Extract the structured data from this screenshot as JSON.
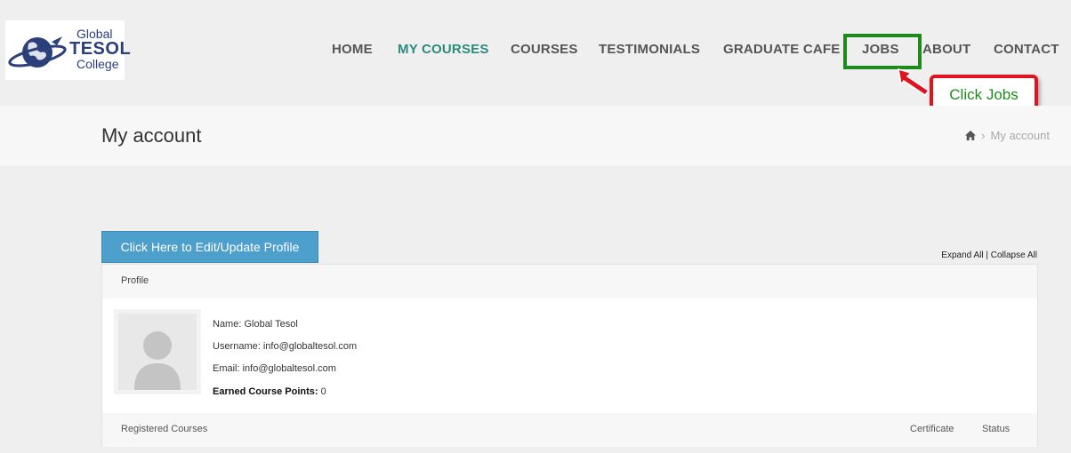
{
  "logo": {
    "line1": "Global",
    "line2": "TESOL",
    "line3": "College"
  },
  "nav": {
    "items": [
      {
        "label": "HOME",
        "active": false
      },
      {
        "label": "MY COURSES",
        "active": true
      },
      {
        "label": "COURSES",
        "active": false
      },
      {
        "label": "TESTIMONIALS",
        "active": false
      },
      {
        "label": "GRADUATE CAFE",
        "active": false
      },
      {
        "label": "JOBS",
        "active": false
      },
      {
        "label": "ABOUT",
        "active": false
      },
      {
        "label": "CONTACT",
        "active": false
      }
    ]
  },
  "annotation": {
    "callout": "Click Jobs",
    "highlight_color": "#1e8a1e",
    "callout_border_color": "#e0141e"
  },
  "page": {
    "title": "My account",
    "breadcrumb_current": "My account"
  },
  "actions": {
    "edit_profile": "Click Here to Edit/Update Profile",
    "expand_all": "Expand All",
    "separator": "|",
    "collapse_all": "Collapse All"
  },
  "profile": {
    "header": "Profile",
    "name_label": "Name: Global Tesol",
    "username_label": "Username: info@globaltesol.com",
    "email_label": "Email: info@globaltesol.com",
    "points_label": "Earned Course Points:",
    "points_value": "0"
  },
  "courses": {
    "header": "Registered Courses",
    "certificate_col": "Certificate",
    "status_col": "Status"
  },
  "colors": {
    "accent": "#2b8a7e",
    "button": "#4ea0cc",
    "background": "#efefef"
  }
}
